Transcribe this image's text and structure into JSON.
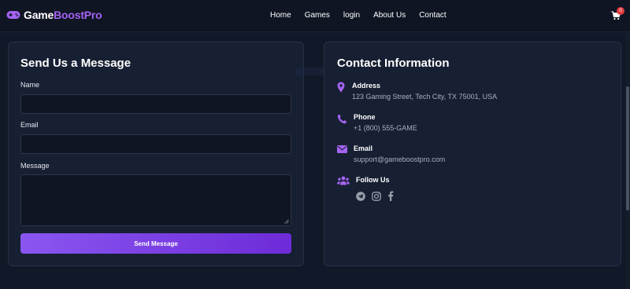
{
  "brand": {
    "name_white": "Game",
    "name_purple": "BoostPro",
    "accent": "#a463f2"
  },
  "nav": {
    "links": [
      "Home",
      "Games",
      "login",
      "About Us",
      "Contact"
    ],
    "cart_count": "0"
  },
  "form": {
    "title": "Send Us a Message",
    "name_label": "Name",
    "name_value": "",
    "email_label": "Email",
    "email_value": "",
    "message_label": "Message",
    "message_value": "",
    "submit_label": "Send Message"
  },
  "contact": {
    "title": "Contact Information",
    "address_label": "Address",
    "address_value": "123 Gaming Street, Tech City, TX 75001, USA",
    "phone_label": "Phone",
    "phone_value": "+1 (800) 555-GAME",
    "email_label": "Email",
    "email_value": "support@gameboostpro.com",
    "follow_label": "Follow Us",
    "socials": [
      "telegram-icon",
      "instagram-icon",
      "facebook-icon"
    ]
  }
}
